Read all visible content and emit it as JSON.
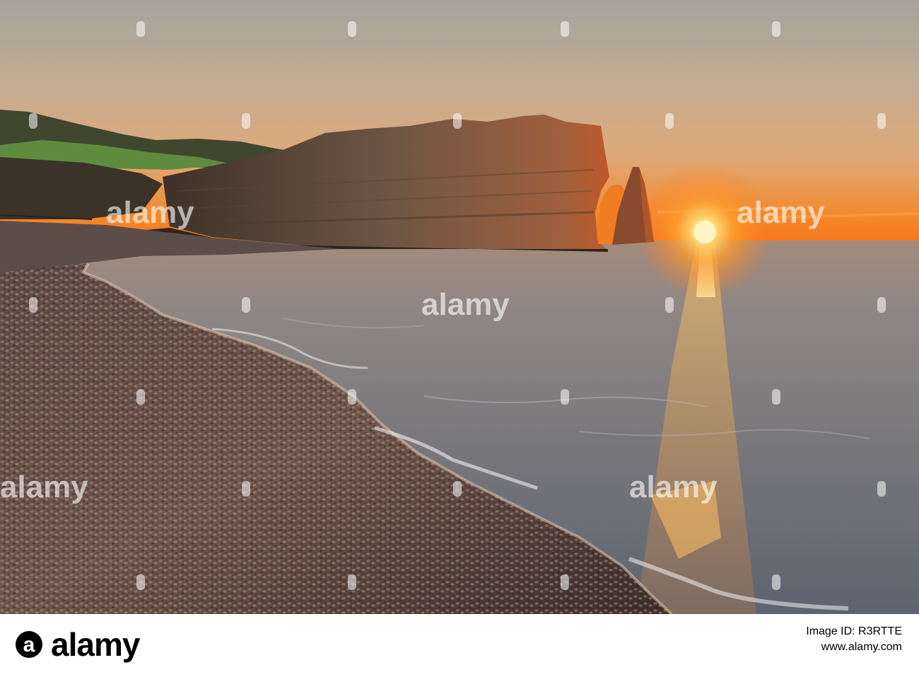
{
  "photo": {
    "subject": "sunset-sea-cliff-arch-pebble-beach",
    "colors": {
      "sky_top": "#a6a29c",
      "sky_mid": "#d3ad84",
      "sky_horizon": "#f08a2a",
      "sun": "#fff6c4",
      "sea_far": "#8d8682",
      "sea_near": "#6c6f78",
      "cliff_dark": "#4a3a2e",
      "cliff_lit": "#8c6a53",
      "grass": "#5a7a3a",
      "beach_dark": "#3b2e2b",
      "beach_lit": "#9a7d6c"
    }
  },
  "watermark": {
    "text": "alamy",
    "icon": "alamy-a-icon"
  },
  "footer": {
    "logo_text": "alamy",
    "image_id_label": "Image ID: R3RTTE",
    "image_id_value": "R3RTTE",
    "url": "www.alamy.com"
  }
}
